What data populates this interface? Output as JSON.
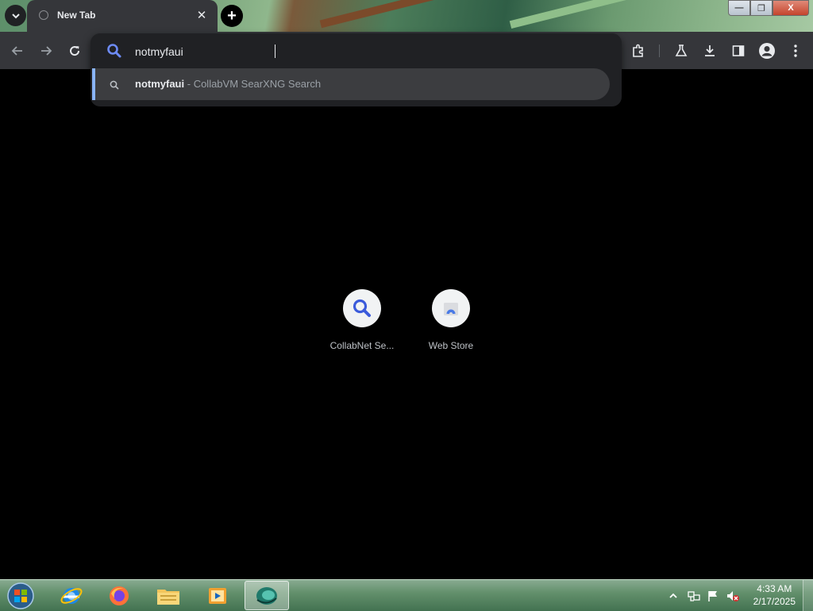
{
  "tab": {
    "title": "New Tab",
    "close": "✕"
  },
  "new_tab": "+",
  "window": {
    "minimize": "—",
    "maximize": "❐",
    "close": "X"
  },
  "omnibox": {
    "value": "notmyfaui"
  },
  "suggestion": {
    "query": "notmyfaui",
    "separator": " - ",
    "engine": "CollabVM SearXNG Search"
  },
  "shortcuts": [
    {
      "label": "CollabNet Se...",
      "icon": "magnifier-icon"
    },
    {
      "label": "Web Store",
      "icon": "web-store-icon"
    }
  ],
  "clock": {
    "time": "4:33 AM",
    "date": "2/17/2025"
  },
  "colors": {
    "accent": "#8ab4f8",
    "toolbar": "#35363a",
    "popup": "#202124"
  }
}
